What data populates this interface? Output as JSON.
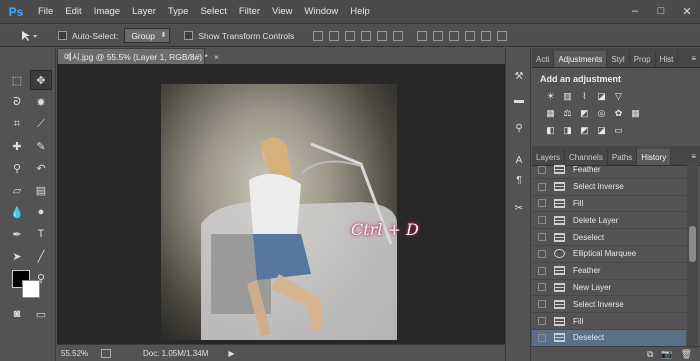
{
  "app": {
    "logo": "Ps"
  },
  "menu": [
    "File",
    "Edit",
    "Image",
    "Layer",
    "Type",
    "Select",
    "Filter",
    "View",
    "Window",
    "Help"
  ],
  "window_controls": [
    "minimize-icon",
    "maximize-icon",
    "close-icon"
  ],
  "options_bar": {
    "auto_select_label": "Auto-Select:",
    "auto_select_value": "Group",
    "transform_label": "Show Transform Controls"
  },
  "document": {
    "tab_title": "예시.jpg @ 55.5% (Layer 1, RGB/8#) *",
    "overlay_text": "Ctrl + D"
  },
  "status": {
    "zoom": "55.52%",
    "doc_size": "Doc: 1.05M/1.34M"
  },
  "panels": {
    "top_tabs": [
      "Acti",
      "Adjustments",
      "Styl",
      "Prop",
      "Hist"
    ],
    "adjustments_title": "Add an adjustment",
    "bottom_tabs": [
      "Layers",
      "Channels",
      "Paths",
      "History"
    ]
  },
  "history": [
    {
      "label": "Feather",
      "icon": "step-icon"
    },
    {
      "label": "Select Inverse",
      "icon": "step-icon"
    },
    {
      "label": "Fill",
      "icon": "step-icon"
    },
    {
      "label": "Delete Layer",
      "icon": "step-icon"
    },
    {
      "label": "Deselect",
      "icon": "step-icon"
    },
    {
      "label": "Elliptical Marquee",
      "icon": "ellipse-icon"
    },
    {
      "label": "Feather",
      "icon": "step-icon"
    },
    {
      "label": "New Layer",
      "icon": "step-icon"
    },
    {
      "label": "Select Inverse",
      "icon": "step-icon"
    },
    {
      "label": "Fill",
      "icon": "step-icon"
    },
    {
      "label": "Deselect",
      "icon": "step-icon",
      "selected": true
    }
  ]
}
